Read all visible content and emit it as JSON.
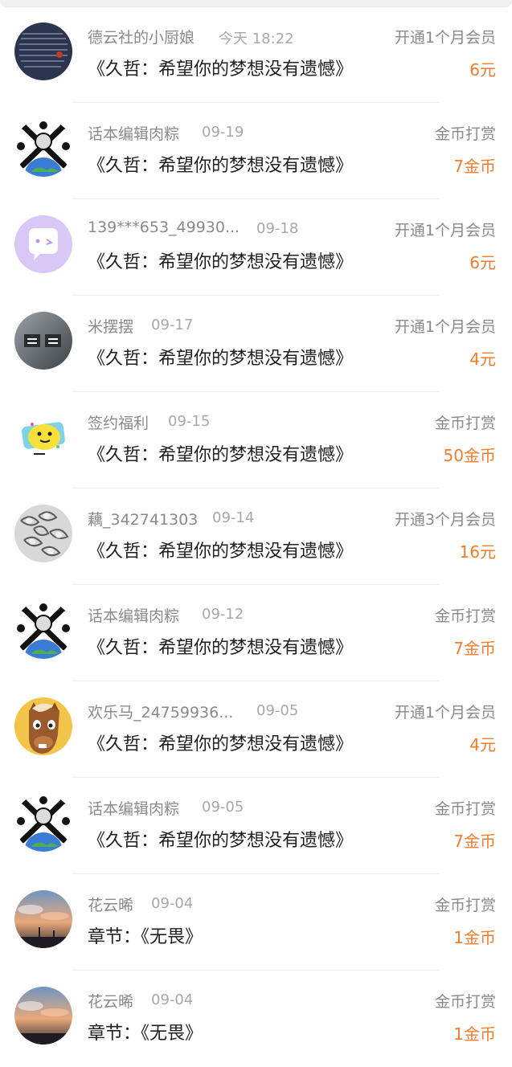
{
  "records": [
    {
      "avatar": "calligraphy-avatar",
      "name": "德云社的小厨娘",
      "time": "今天 18:22",
      "title": "《久哲：希望你的梦想没有遗憾》",
      "type": "开通1个月会员",
      "amount": "6元"
    },
    {
      "avatar": "globe-crossbones-avatar",
      "name": "话本编辑肉粽",
      "time": "09-19",
      "title": "《久哲：希望你的梦想没有遗憾》",
      "type": "金币打赏",
      "amount": "7金币"
    },
    {
      "avatar": "purple-chat-avatar",
      "name": "139***653_49930...",
      "time": "09-18",
      "title": "《久哲：希望你的梦想没有遗憾》",
      "type": "开通1个月会员",
      "amount": "6元"
    },
    {
      "avatar": "gray-text-avatar",
      "name": "米摆摆",
      "time": "09-17",
      "title": "《久哲：希望你的梦想没有遗憾》",
      "type": "开通1个月会员",
      "amount": "4元"
    },
    {
      "avatar": "yellow-smiley-avatar",
      "name": "签约福利",
      "time": "09-15",
      "title": "《久哲：希望你的梦想没有遗憾》",
      "type": "金币打赏",
      "amount": "50金币"
    },
    {
      "avatar": "monochrome-flower-avatar",
      "name": "藕_342741303",
      "time": "09-14",
      "title": "《久哲：希望你的梦想没有遗憾》",
      "type": "开通3个月会员",
      "amount": "16元"
    },
    {
      "avatar": "globe-crossbones-avatar",
      "name": "话本编辑肉粽",
      "time": "09-12",
      "title": "《久哲：希望你的梦想没有遗憾》",
      "type": "金币打赏",
      "amount": "7金币"
    },
    {
      "avatar": "cartoon-horse-avatar",
      "name": "欢乐马_24759936...",
      "time": "09-05",
      "title": "《久哲：希望你的梦想没有遗憾》",
      "type": "开通1个月会员",
      "amount": "4元"
    },
    {
      "avatar": "globe-crossbones-avatar",
      "name": "话本编辑肉粽",
      "time": "09-05",
      "title": "《久哲：希望你的梦想没有遗憾》",
      "type": "金币打赏",
      "amount": "7金币"
    },
    {
      "avatar": "sunset-sky-avatar",
      "name": "花云晞",
      "time": "09-04",
      "title": "章节：《无畏》",
      "type": "金币打赏",
      "amount": "1金币"
    },
    {
      "avatar": "sunset-sky-avatar",
      "name": "花云晞",
      "time": "09-04",
      "title": "章节：《无畏》",
      "type": "金币打赏",
      "amount": "1金币"
    }
  ],
  "colors": {
    "amount": "#f07c2c",
    "secondary_text": "#8a8a8a",
    "primary_text": "#1f1f1f"
  }
}
